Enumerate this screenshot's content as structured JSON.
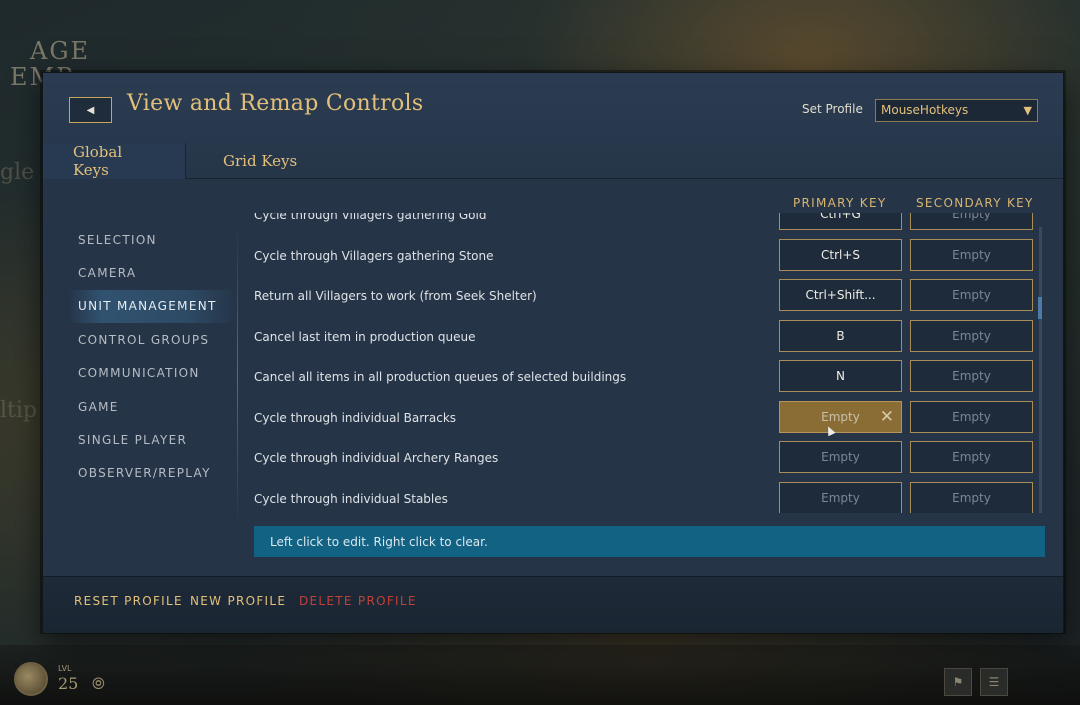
{
  "background": {
    "logo_line1": "AGE",
    "logo_line2": "EMP",
    "side_text_1": "gle",
    "side_text_2": "ltip",
    "hud_level_label": "LVL",
    "hud_level": "25"
  },
  "dialog": {
    "title": "View and Remap Controls",
    "profile_label": "Set Profile",
    "profile_value": "MouseHotkeys",
    "tabs": [
      {
        "label": "Global Keys",
        "active": true
      },
      {
        "label": "Grid Keys",
        "active": false
      }
    ],
    "columns": {
      "primary": "PRIMARY KEY",
      "secondary": "SECONDARY KEY"
    },
    "categories": [
      {
        "label": "SELECTION",
        "active": false
      },
      {
        "label": "CAMERA",
        "active": false
      },
      {
        "label": "UNIT MANAGEMENT",
        "active": true
      },
      {
        "label": "CONTROL GROUPS",
        "active": false
      },
      {
        "label": "COMMUNICATION",
        "active": false
      },
      {
        "label": "GAME",
        "active": false
      },
      {
        "label": "SINGLE PLAYER",
        "active": false
      },
      {
        "label": "OBSERVER/REPLAY",
        "active": false
      }
    ],
    "rows": [
      {
        "label": "Cycle through Villagers gathering Gold",
        "primary": "Ctrl+G",
        "secondary": "Empty"
      },
      {
        "label": "Cycle through Villagers gathering Stone",
        "primary": "Ctrl+S",
        "secondary": "Empty"
      },
      {
        "label": "Return all Villagers to work (from Seek Shelter)",
        "primary": "Ctrl+Shift...",
        "secondary": "Empty"
      },
      {
        "label": "Cancel last item in production queue",
        "primary": "B",
        "secondary": "Empty"
      },
      {
        "label": "Cancel all items in all production queues of selected buildings",
        "primary": "N",
        "secondary": "Empty"
      },
      {
        "label": "Cycle through individual Barracks",
        "primary": "Empty",
        "secondary": "Empty",
        "selected": true
      },
      {
        "label": "Cycle through individual Archery Ranges",
        "primary": "Empty",
        "secondary": "Empty"
      },
      {
        "label": "Cycle through individual Stables",
        "primary": "Empty",
        "secondary": "Empty"
      }
    ],
    "hint": "Left click to edit. Right click to clear.",
    "footer": {
      "reset": "RESET PROFILE",
      "new": "NEW PROFILE",
      "delete": "DELETE PROFILE"
    },
    "colors": {
      "gold": "#e3c07a",
      "danger": "#c0403a",
      "hint_bg": "#126283",
      "selected_key": "#8a6d35"
    }
  }
}
